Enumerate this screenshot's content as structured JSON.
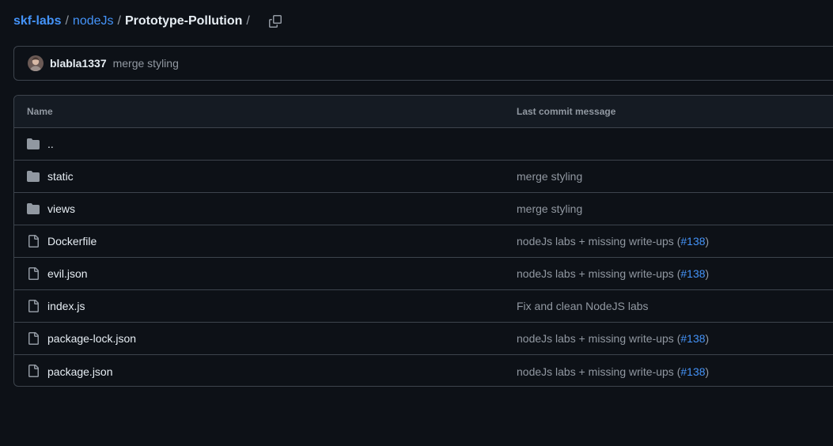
{
  "breadcrumb": {
    "org": "skf-labs",
    "folder": "nodeJs",
    "current": "Prototype-Pollution",
    "separator": "/",
    "copy_icon": "copy-icon"
  },
  "latest_commit": {
    "avatar_icon": "avatar",
    "author": "blabla1337",
    "message": "merge styling"
  },
  "table": {
    "headers": {
      "name": "Name",
      "message": "Last commit message"
    },
    "parent_dir": "..",
    "rows": [
      {
        "type": "folder",
        "icon": "folder-icon",
        "name": "static",
        "message": "merge styling",
        "pr": ""
      },
      {
        "type": "folder",
        "icon": "folder-icon",
        "name": "views",
        "message": "merge styling",
        "pr": ""
      },
      {
        "type": "file",
        "icon": "file-icon",
        "name": "Dockerfile",
        "message": "nodeJs labs + missing write-ups (",
        "pr": "#138",
        "close": ")"
      },
      {
        "type": "file",
        "icon": "file-icon",
        "name": "evil.json",
        "message": "nodeJs labs + missing write-ups (",
        "pr": "#138",
        "close": ")"
      },
      {
        "type": "file",
        "icon": "file-icon",
        "name": "index.js",
        "message": "Fix and clean NodeJS labs",
        "pr": ""
      },
      {
        "type": "file",
        "icon": "file-icon",
        "name": "package-lock.json",
        "message": "nodeJs labs + missing write-ups (",
        "pr": "#138",
        "close": ")"
      },
      {
        "type": "file",
        "icon": "file-icon",
        "name": "package.json",
        "message": "nodeJs labs + missing write-ups (",
        "pr": "#138",
        "close": ")"
      }
    ]
  },
  "colors": {
    "background": "#0d1117",
    "header_bg": "#151b23",
    "border": "#3d444d",
    "link": "#4493f8",
    "muted": "#9198a1",
    "text": "#e6edf3"
  }
}
